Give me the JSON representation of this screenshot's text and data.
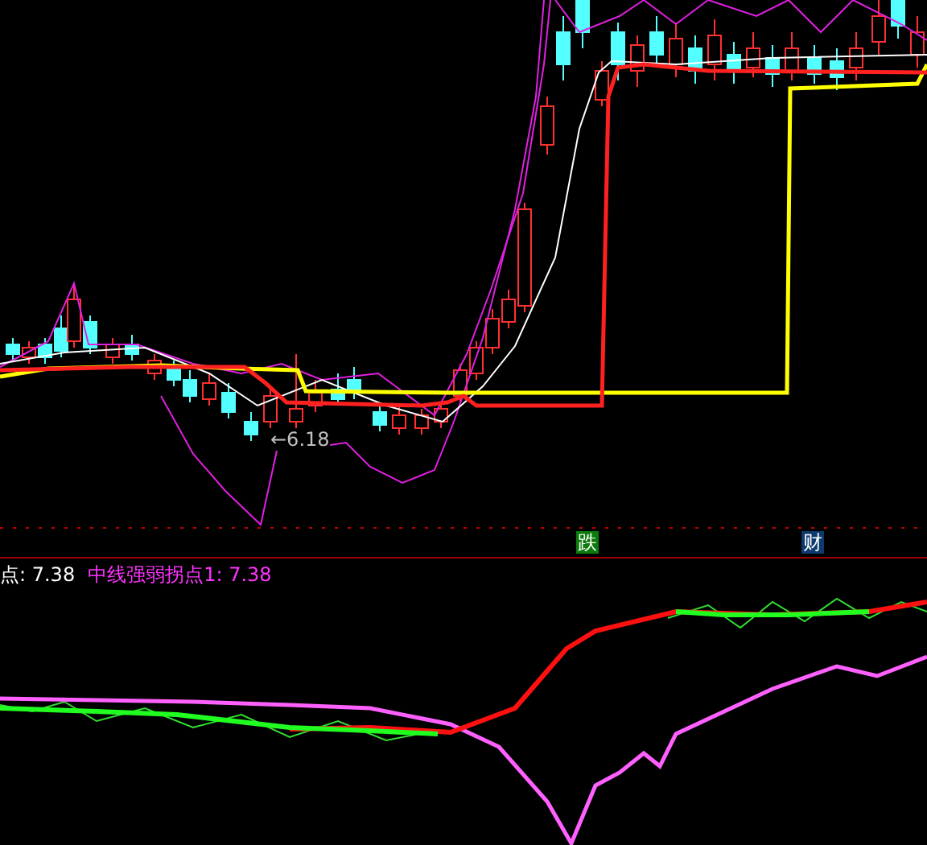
{
  "price_chart": {
    "price_marker": {
      "text": "←6.18"
    },
    "signal_badges": [
      {
        "text": "跌",
        "color": "#0c7a0c"
      },
      {
        "text": "财",
        "color": "#0d3a6e"
      }
    ]
  },
  "indicator_legend": [
    {
      "text": "点: 7.38",
      "color": "#ffffff"
    },
    {
      "text": "中线强弱拐点1: 7.38",
      "color": "#ff33ff"
    }
  ]
}
